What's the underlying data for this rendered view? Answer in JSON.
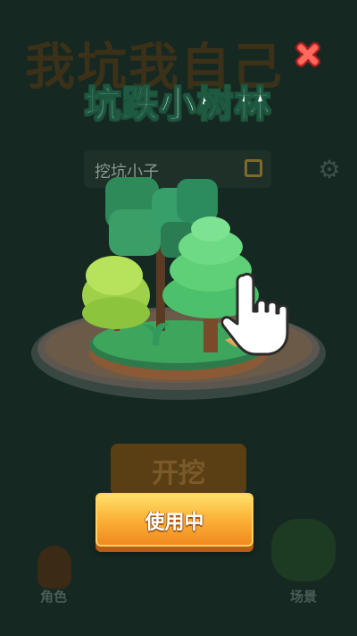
{
  "background": {
    "game_title": "我坑我自己",
    "player_name": "挖坑小子",
    "start_button_label": "开挖",
    "role_tab_label": "角色",
    "scene_tab_label": "场景"
  },
  "popup": {
    "title": "坑跌小树林",
    "close_icon": "close-x-icon",
    "use_button_label": "使用中"
  },
  "colors": {
    "title_outline": "#1d4d38",
    "close_red": "#e8413a",
    "button_top": "#ffe06a",
    "button_bottom": "#f08a1f"
  }
}
